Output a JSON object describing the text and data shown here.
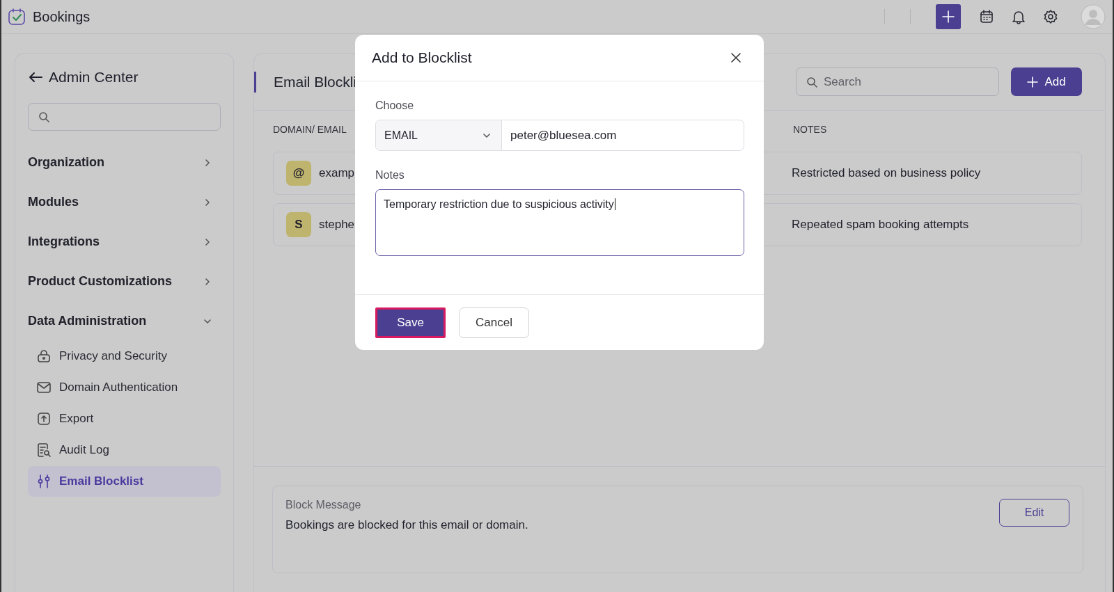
{
  "app": {
    "title": "Bookings"
  },
  "sidebar": {
    "back_label": "Admin Center",
    "sections": [
      {
        "label": "Organization",
        "expanded": false
      },
      {
        "label": "Modules",
        "expanded": false
      },
      {
        "label": "Integrations",
        "expanded": false
      },
      {
        "label": "Product Customizations",
        "expanded": false
      },
      {
        "label": "Data Administration",
        "expanded": true,
        "children": [
          {
            "label": "Privacy and Security",
            "selected": false
          },
          {
            "label": "Domain Authentication",
            "selected": false
          },
          {
            "label": "Export",
            "selected": false
          },
          {
            "label": "Audit Log",
            "selected": false
          },
          {
            "label": "Email Blocklist",
            "selected": true
          }
        ]
      }
    ]
  },
  "page": {
    "title": "Email Blockli",
    "search": {
      "placeholder": "Search"
    },
    "add_button": "Add",
    "columns": [
      "DOMAIN/ EMAIL",
      "NOTES"
    ],
    "rows": [
      {
        "avatar": "@",
        "entry": "examp",
        "notes": "Restricted based on business policy"
      },
      {
        "avatar": "S",
        "entry": "stephe",
        "notes": "Repeated spam booking attempts"
      }
    ],
    "block_message": {
      "label": "Block Message",
      "text": "Bookings are blocked for this email or domain.",
      "edit_button": "Edit"
    }
  },
  "dialog": {
    "title": "Add to Blocklist",
    "choose_label": "Choose",
    "type_value": "EMAIL",
    "email_value": "peter@bluesea.com",
    "notes_label": "Notes",
    "notes_value": "Temporary restriction due to suspicious activity",
    "buttons": [
      {
        "label": "Save",
        "kind": "primary",
        "focused": true
      },
      {
        "label": "Cancel",
        "kind": "secondary",
        "focused": false
      }
    ]
  }
}
